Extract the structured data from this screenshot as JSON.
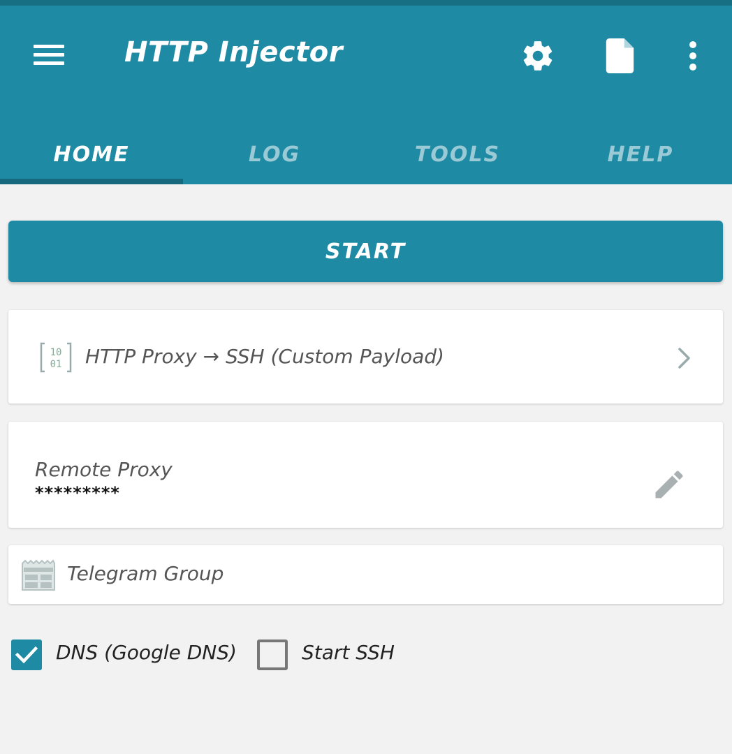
{
  "app": {
    "title": "HTTP Injector",
    "accent_color": "#1e8aa3",
    "icons": [
      "menu-icon",
      "gear-icon",
      "document-icon",
      "more-vert-icon"
    ]
  },
  "tabs": [
    {
      "label": "HOME",
      "active": true
    },
    {
      "label": "LOG",
      "active": false
    },
    {
      "label": "TOOLS",
      "active": false
    },
    {
      "label": "HELP",
      "active": false
    }
  ],
  "main": {
    "start_label": "START",
    "mode": {
      "icon": "binary-icon",
      "label": "HTTP Proxy → SSH (Custom Payload)"
    },
    "remote_proxy": {
      "label": "Remote Proxy",
      "value": "*********",
      "icon": "pencil-icon"
    },
    "telegram": {
      "icon": "newspaper-icon",
      "label": "Telegram Group"
    },
    "options": [
      {
        "label": "DNS (Google DNS)",
        "checked": true
      },
      {
        "label": "Start SSH",
        "checked": false
      }
    ]
  }
}
